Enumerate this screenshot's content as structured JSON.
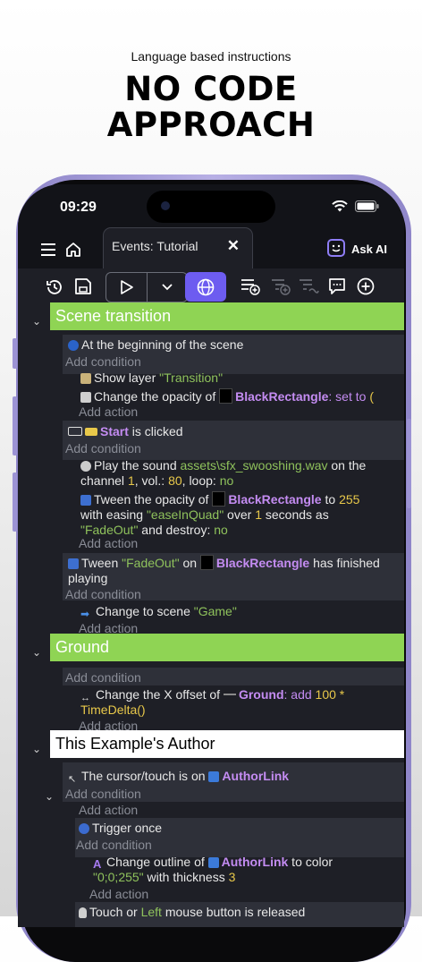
{
  "promo": {
    "tagline": "Language based instructions",
    "headline_1": "NO CODE",
    "headline_2": "APPROACH"
  },
  "status": {
    "time": "09:29"
  },
  "app": {
    "tab_label": "Events: Tutorial",
    "ask_ai": "Ask AI"
  },
  "colors": {
    "group_green": "#8fd454",
    "group_white": "#ffffff",
    "object_name": "#c48cf2",
    "string": "#8fc25c",
    "number": "#e8c84a",
    "accent": "#6d5cf0"
  },
  "events": {
    "g1": {
      "title": "Scene transition"
    },
    "e1": {
      "cond": "At the beginning of the scene",
      "add_condition": "Add condition",
      "a1_pre": "Show layer ",
      "a1_str": "\"Transition\"",
      "a2_pre": "Change the opacity of ",
      "a2_obj": "BlackRectangle",
      "a2_post": ": set to ",
      "a2_tail": "(",
      "add_action": "Add action"
    },
    "e2": {
      "cond_obj": "Start",
      "cond_post": " is clicked",
      "add_condition": "Add condition",
      "a1_pre": "Play the sound ",
      "a1_str": "assets\\sfx_swooshing.wav",
      "a1_mid": " on the",
      "a1_l2a": "channel ",
      "a1_n1": "1",
      "a1_l2b": ", vol.: ",
      "a1_n2": "80",
      "a1_l2c": ", loop: ",
      "a1_l2d": "no",
      "a2_pre": "Tween the opacity of ",
      "a2_obj": "BlackRectangle",
      "a2_mid": " to ",
      "a2_n": "255",
      "a2_l2a": "with easing ",
      "a2_s1": "\"easeInQuad\"",
      "a2_l2b": " over ",
      "a2_n2": "1",
      "a2_l2c": " seconds as",
      "a2_s2": "\"FadeOut\"",
      "a2_l3a": " and destroy: ",
      "a2_l3b": "no",
      "add_action": "Add action"
    },
    "e3": {
      "c_pre": "Tween ",
      "c_str": "\"FadeOut\"",
      "c_mid": " on ",
      "c_obj": "BlackRectangle",
      "c_post": " has finished",
      "c_l2": "playing",
      "add_condition": "Add condition",
      "a1_pre": "Change to scene ",
      "a1_str": "\"Game\"",
      "add_action": "Add action"
    },
    "g2": {
      "title": "Ground"
    },
    "e4": {
      "add_condition": "Add condition",
      "a1_pre": "Change the X offset of ",
      "a1_obj": "Ground",
      "a1_mid": ": add ",
      "a1_n": "100",
      "a1_op": " *",
      "a1_l2": "TimeDelta()",
      "add_action": "Add action"
    },
    "g3": {
      "title": "This Example's Author"
    },
    "e5": {
      "c_pre": "The cursor/touch is on ",
      "c_obj": "AuthorLink",
      "add_condition": "Add condition",
      "add_action": "Add action"
    },
    "e6": {
      "cond": "Trigger once",
      "add_condition": "Add condition",
      "a1_pre": "Change outline of ",
      "a1_obj": "AuthorLink",
      "a1_mid": " to color",
      "a1_str": "\"0;0;255\"",
      "a1_l2": " with thickness ",
      "a1_n": "3",
      "add_action": "Add action"
    },
    "e7": {
      "c_pre": "Touch or ",
      "c_str": "Left",
      "c_post": " mouse button is released"
    }
  }
}
